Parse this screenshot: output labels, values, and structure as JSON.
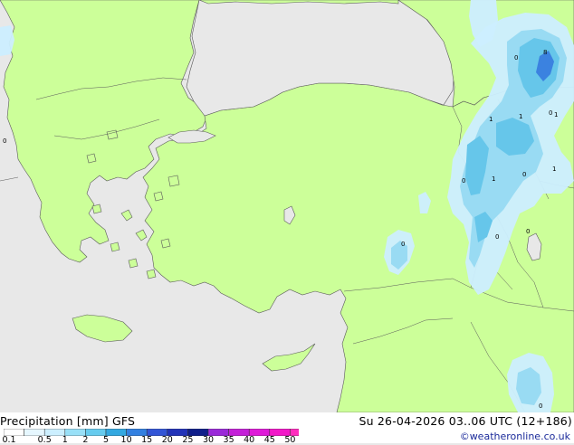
{
  "map": {
    "title": "Precipitation [mm]",
    "model": "GFS",
    "valid_time": "Su 26-04-2026 03..06 UTC (12+186)",
    "credit": "©weatheronline.co.uk",
    "colors": {
      "sea": "#e8e8e8",
      "land": "#ccff99",
      "precip_light": "#cceeff",
      "precip_mid": "#99dbf3",
      "precip_heavy": "#66c6ea",
      "precip_max": "#3b82e0",
      "coast": "#5a5a5a"
    },
    "legend": {
      "labels": [
        "0.1",
        "0.5",
        "1",
        "2",
        "5",
        "10",
        "15",
        "20",
        "25",
        "30",
        "35",
        "40",
        "45",
        "50"
      ],
      "colors": [
        "#ffffff",
        "#e6f7ff",
        "#ccefff",
        "#99e0f7",
        "#66cbee",
        "#33a8e0",
        "#3380e0",
        "#3355d6",
        "#2233b8",
        "#101e8a",
        "#9a2ad8",
        "#c421d8",
        "#de1ad8",
        "#f218c8",
        "#ff2dbd"
      ]
    },
    "point_values": [
      "0",
      "8",
      "0",
      "1",
      "1",
      "0",
      "1",
      "1",
      "0",
      "0",
      "0",
      "0",
      "0",
      "1",
      "0",
      "0"
    ]
  }
}
